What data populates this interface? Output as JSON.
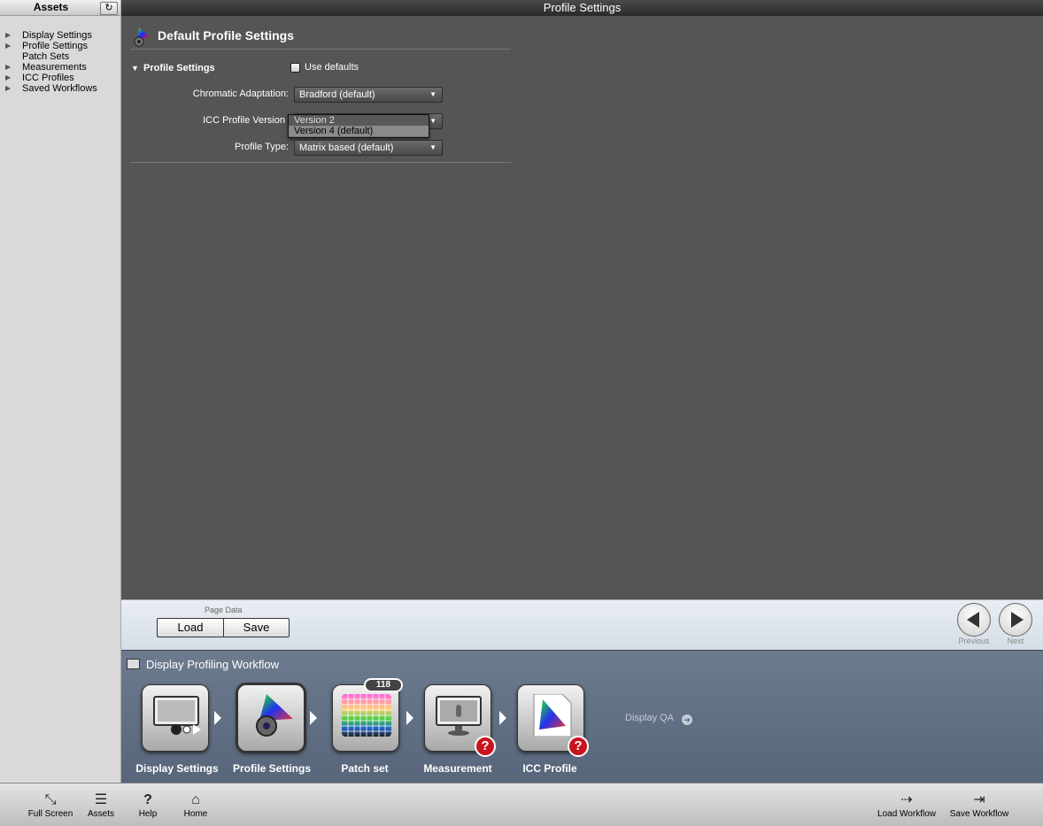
{
  "window": {
    "title": "Profile Settings"
  },
  "sidebar": {
    "title": "Assets",
    "items": [
      {
        "label": "Display Settings"
      },
      {
        "label": "Profile Settings"
      },
      {
        "label": "Patch Sets"
      },
      {
        "label": "Measurements"
      },
      {
        "label": "ICC Profiles"
      },
      {
        "label": "Saved Workflows"
      }
    ]
  },
  "main": {
    "page_title": "Default Profile Settings",
    "section_title": "Profile Settings",
    "use_defaults_label": "Use defaults",
    "use_defaults_checked": false,
    "fields": {
      "chromatic_adaptation": {
        "label": "Chromatic Adaptation:",
        "value": "Bradford (default)"
      },
      "icc_profile_version": {
        "label": "ICC Profile Version",
        "options": [
          "Version 2",
          "Version 4 (default)"
        ]
      },
      "profile_type": {
        "label": "Profile Type:",
        "value": "Matrix based (default)"
      }
    }
  },
  "page_data": {
    "label": "Page Data",
    "load": "Load",
    "save": "Save",
    "previous": "Previous",
    "next": "Next"
  },
  "workflow": {
    "title": "Display Profiling Workflow",
    "steps": [
      {
        "label": "Display Settings"
      },
      {
        "label": "Profile Settings"
      },
      {
        "label": "Patch set",
        "badge": "118"
      },
      {
        "label": "Measurement",
        "badge": "?"
      },
      {
        "label": "ICC Profile",
        "badge": "?"
      }
    ],
    "display_qa": "Display QA"
  },
  "toolbar": {
    "full_screen": "Full Screen",
    "assets": "Assets",
    "help": "Help",
    "home": "Home",
    "load_workflow": "Load Workflow",
    "save_workflow": "Save Workflow"
  }
}
